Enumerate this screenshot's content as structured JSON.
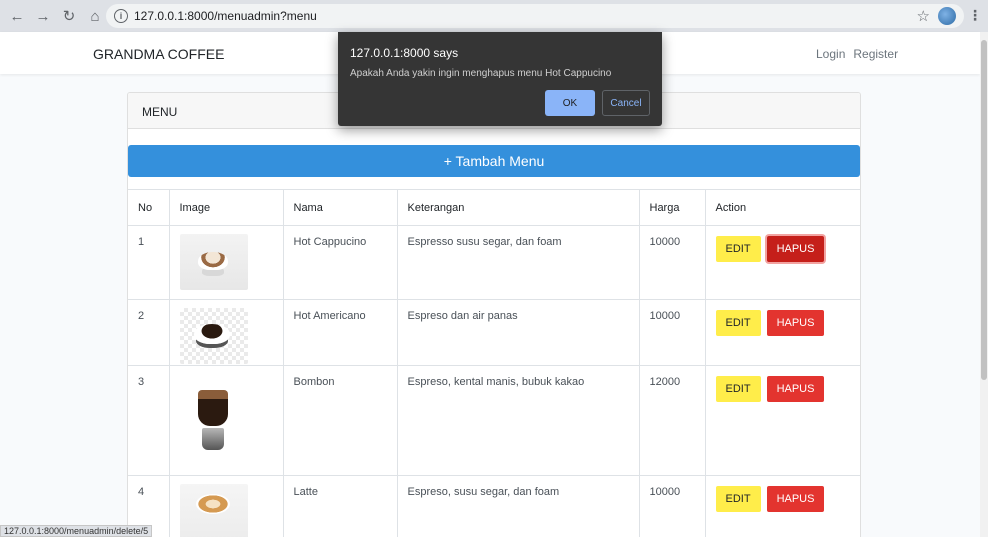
{
  "browser": {
    "url": "127.0.0.1:8000/menuadmin?menu",
    "status_url": "127.0.0.1:8000/menuadmin/delete/5"
  },
  "navbar": {
    "brand": "GRANDMA COFFEE",
    "login": "Login",
    "register": "Register"
  },
  "card": {
    "header": "MENU",
    "add_button": "+ Tambah Menu"
  },
  "table": {
    "headers": [
      "No",
      "Image",
      "Nama",
      "Keterangan",
      "Harga",
      "Action"
    ],
    "rows": [
      {
        "no": "1",
        "nama": "Hot Cappucino",
        "keterangan": "Espresso susu segar, dan foam",
        "harga": "10000"
      },
      {
        "no": "2",
        "nama": "Hot Americano",
        "keterangan": "Espreso dan air panas",
        "harga": "10000"
      },
      {
        "no": "3",
        "nama": "Bombon",
        "keterangan": "Espreso, kental manis, bubuk kakao",
        "harga": "12000"
      },
      {
        "no": "4",
        "nama": "Latte",
        "keterangan": "Espreso, susu segar, dan foam",
        "harga": "10000"
      }
    ],
    "edit_label": "EDIT",
    "hapus_label": "HAPUS"
  },
  "dialog": {
    "title": "127.0.0.1:8000 says",
    "message": "Apakah Anda yakin ingin menghapus menu Hot Cappucino",
    "ok": "OK",
    "cancel": "Cancel"
  },
  "colors": {
    "primary": "#3490dc",
    "warning": "#ffed4a",
    "danger": "#e3342f"
  }
}
